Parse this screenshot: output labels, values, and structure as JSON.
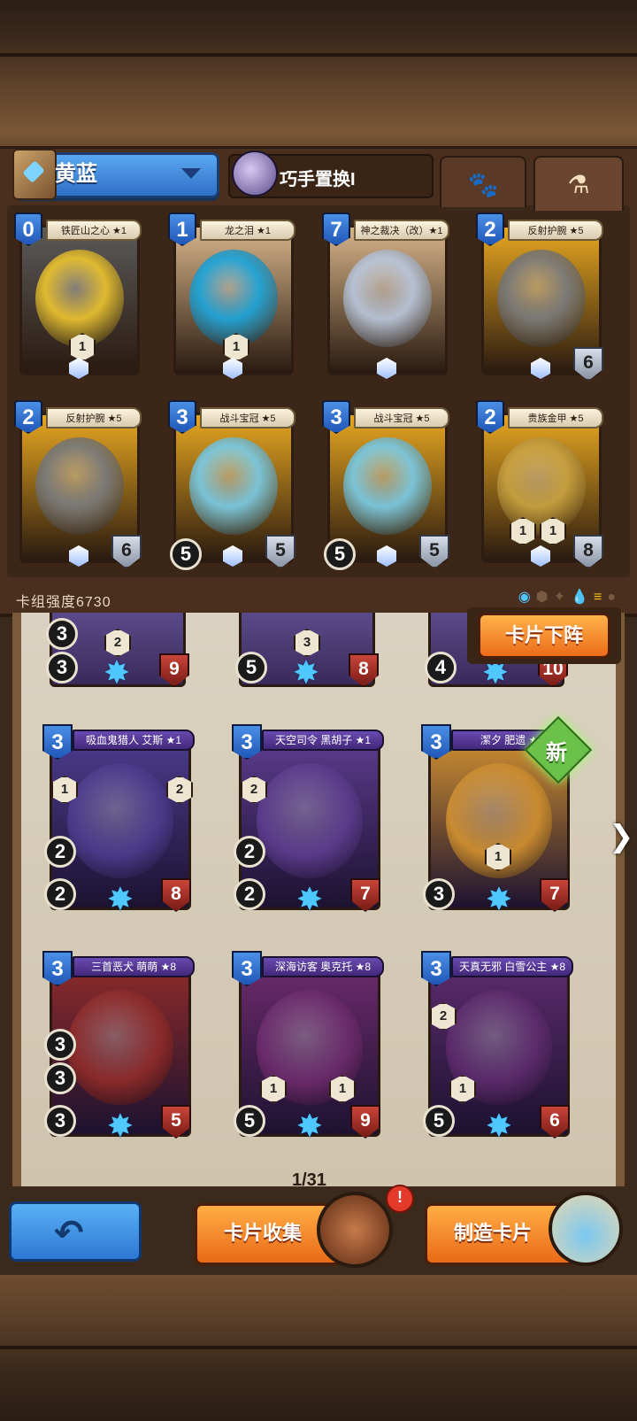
{
  "deck": {
    "name": "黄蓝",
    "swap_label": "巧手置换I",
    "power_label": "卡组强度6730"
  },
  "deck_cards": [
    {
      "name": "铁匠山之心 ★1",
      "cost": "0",
      "gem": "1",
      "bg": "#5a5a5a",
      "art": "#e8c030"
    },
    {
      "name": "龙之泪 ★1",
      "cost": "1",
      "gem": "1",
      "bg": "#d6b48a",
      "art": "#1fa4d8"
    },
    {
      "name": "神之裁决（改）★1",
      "cost": "7",
      "gem": "",
      "bg": "#d6b48a",
      "art": "#b8c4d8"
    },
    {
      "name": "反射护腕 ★5",
      "cost": "2",
      "health": "6",
      "bg": "#e6a620",
      "art": "#7a7a7a"
    },
    {
      "name": "反射护腕 ★5",
      "cost": "2",
      "health": "6",
      "bg": "#e6a620",
      "art": "#7a7a7a"
    },
    {
      "name": "战斗宝冠 ★5",
      "cost": "3",
      "attack": "5",
      "health": "5",
      "bg": "#e6a620",
      "art": "#7ac8e0"
    },
    {
      "name": "战斗宝冠 ★5",
      "cost": "3",
      "attack": "5",
      "health": "5",
      "bg": "#e6a620",
      "art": "#7ac8e0"
    },
    {
      "name": "贵族金甲 ★5",
      "cost": "2",
      "left_gem": "1",
      "right_gem": "1",
      "health": "8",
      "bg": "#e6a620",
      "art": "#c8a040"
    }
  ],
  "partial_row": [
    {
      "top": "3",
      "bottom": "3",
      "gem": "2",
      "health": "9"
    },
    {
      "bottom": "5",
      "gem": "3",
      "health": "8"
    },
    {
      "bottom": "4",
      "health": "10"
    }
  ],
  "collection_cards": [
    {
      "name": "吸血鬼猎人 艾斯 ★1",
      "cost": "3",
      "left_gem": "1",
      "right_gem": "2",
      "a": "2",
      "b": "2",
      "health": "8",
      "bg": "#4a3a8a"
    },
    {
      "name": "天空司令 黑胡子 ★1",
      "cost": "3",
      "left_gem": "2",
      "a": "2",
      "b": "2",
      "health": "7",
      "bg": "#5a3a8a"
    },
    {
      "name": "潔夕 肥遗 ★1",
      "cost": "3",
      "mid_gem": "1",
      "b": "3",
      "health": "7",
      "bg": "#c88a30",
      "new": "新"
    },
    {
      "name": "三首恶犬 萌萌 ★8",
      "cost": "3",
      "a": "3",
      "a2": "3",
      "b": "3",
      "health": "5",
      "bg": "#8a2a2a"
    },
    {
      "name": "深海访客 奥克托 ★8",
      "cost": "3",
      "gem1": "1",
      "gem2": "1",
      "b": "5",
      "health": "9",
      "bg": "#6a2a6a"
    },
    {
      "name": "天真无邪 白雪公主 ★8",
      "cost": "3",
      "left_gem": "2",
      "gem1": "1",
      "b": "5",
      "health": "6",
      "bg": "#5a2a6a"
    }
  ],
  "buttons": {
    "unmount": "卡片下阵",
    "collection": "卡片收集",
    "craft": "制造卡片",
    "alert": "!"
  },
  "page": "1/31",
  "colors": {
    "accent_blue": "#2f6fc7",
    "accent_orange": "#ec6c1a",
    "panel_brown": "#4a2f1f"
  }
}
